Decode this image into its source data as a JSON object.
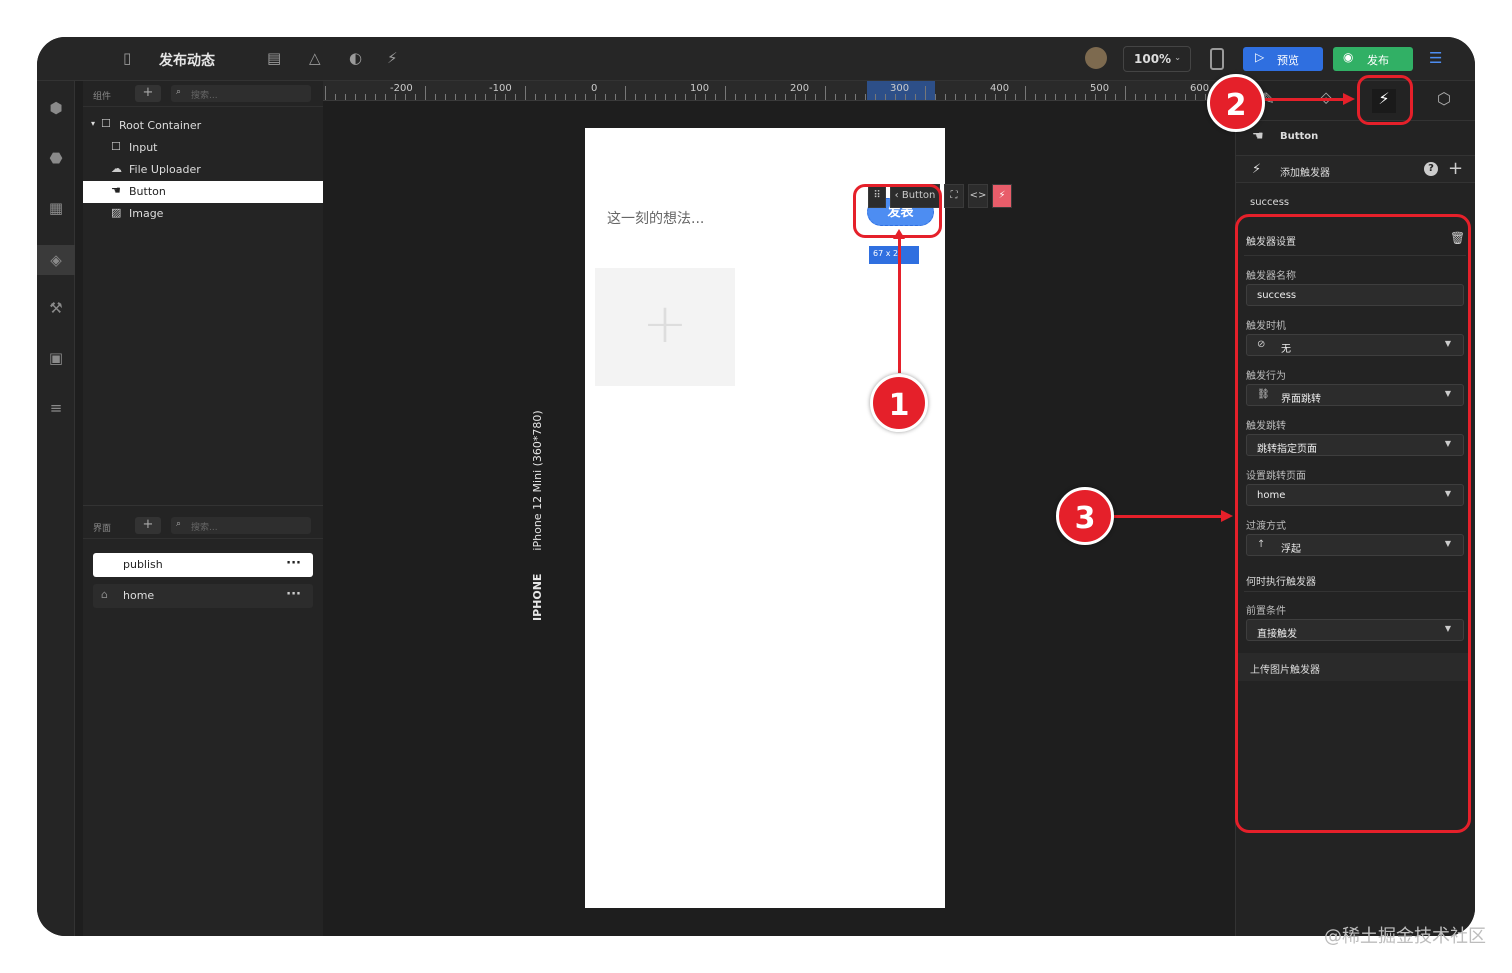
{
  "toolbar": {
    "title": "发布动态",
    "zoom": "100%",
    "preview_label": "预览",
    "publish_label": "发布"
  },
  "components_panel": {
    "header": "组件",
    "search_placeholder": "搜索...",
    "tree": [
      {
        "label": "Root Container",
        "icon": "square-icon"
      },
      {
        "label": "Input",
        "icon": "square-icon"
      },
      {
        "label": "File Uploader",
        "icon": "cloud-upload-icon"
      },
      {
        "label": "Button",
        "icon": "hand-pointer-icon",
        "selected": true
      },
      {
        "label": "Image",
        "icon": "image-icon"
      }
    ]
  },
  "pages_panel": {
    "header": "界面",
    "search_placeholder": "搜索...",
    "pages": [
      {
        "label": "publish",
        "selected": true
      },
      {
        "label": "home",
        "icon": "home-icon"
      }
    ]
  },
  "ruler": {
    "labels": [
      "-200",
      "-100",
      "0",
      "100",
      "200",
      "300",
      "400",
      "500",
      "600"
    ]
  },
  "canvas": {
    "device_label": "iPhone 12 Mini (360*780)",
    "device_type": "IPHONE",
    "input_placeholder": "这一刻的想法...",
    "button_label": "发表",
    "size_label": "67 x 2",
    "float_toolbar_label": "Button"
  },
  "right_panel": {
    "component_name": "Button",
    "add_trigger_label": "添加触发器",
    "trigger_list_item": "success",
    "settings_title": "触发器设置",
    "fields": [
      {
        "label": "触发器名称",
        "value": "success",
        "type": "input"
      },
      {
        "label": "触发时机",
        "value": "无",
        "type": "select",
        "icon": "ban-icon"
      },
      {
        "label": "触发行为",
        "value": "界面跳转",
        "type": "select",
        "icon": "link-icon"
      },
      {
        "label": "触发跳转",
        "value": "跳转指定页面",
        "type": "select"
      },
      {
        "label": "设置跳转页面",
        "value": "home",
        "type": "select"
      },
      {
        "label": "过渡方式",
        "value": "浮起",
        "type": "select",
        "icon": "arrow-up-icon"
      }
    ],
    "when_title": "何时执行触发器",
    "precondition_label": "前置条件",
    "precondition_value": "直接触发",
    "upload_trigger_section": "上传图片触发器"
  },
  "annotations": {
    "badge1": "1",
    "badge2": "2",
    "badge3": "3",
    "color": "#e5202a"
  },
  "watermark": "@稀土掘金技术社区"
}
